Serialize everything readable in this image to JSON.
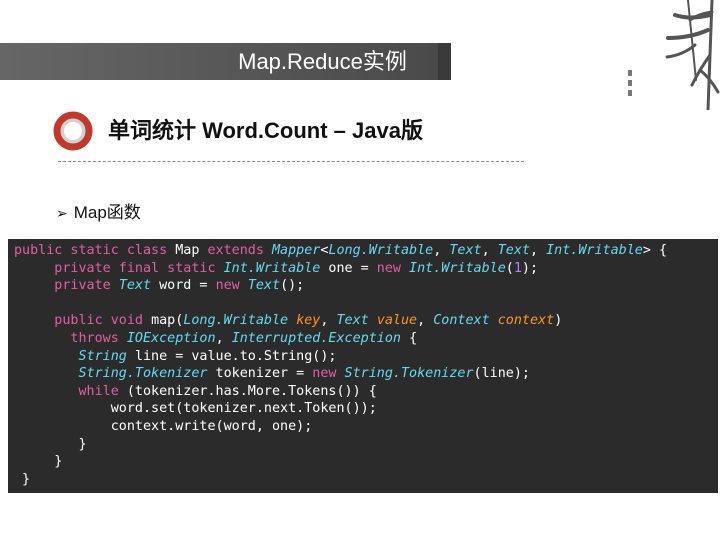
{
  "header": {
    "title": "Map.Reduce实例"
  },
  "section": {
    "subtitle": "单词统计 Word.Count – Java版",
    "bullet_label": "Map函数"
  },
  "code": {
    "lines": [
      [
        [
          "kw",
          "public static class "
        ],
        [
          "pl",
          "Map "
        ],
        [
          "kw",
          "extends "
        ],
        [
          "ty",
          "Mapper"
        ],
        [
          "pl",
          "<"
        ],
        [
          "ty",
          "Long.Writable"
        ],
        [
          "pl",
          ", "
        ],
        [
          "ty",
          "Text"
        ],
        [
          "pl",
          ", "
        ],
        [
          "ty",
          "Text"
        ],
        [
          "pl",
          ", "
        ],
        [
          "ty",
          "Int.Writable"
        ],
        [
          "pl",
          "> {"
        ]
      ],
      [
        [
          "kw",
          "     private final static "
        ],
        [
          "ty",
          "Int.Writable "
        ],
        [
          "pl",
          "one = "
        ],
        [
          "kw",
          "new "
        ],
        [
          "ty",
          "Int.Writable"
        ],
        [
          "pl",
          "("
        ],
        [
          "nu",
          "1"
        ],
        [
          "pl",
          ");"
        ]
      ],
      [
        [
          "kw",
          "     private "
        ],
        [
          "ty",
          "Text "
        ],
        [
          "pl",
          "word = "
        ],
        [
          "kw",
          "new "
        ],
        [
          "ty",
          "Text"
        ],
        [
          "pl",
          "();"
        ]
      ],
      [
        [
          "pl",
          ""
        ]
      ],
      [
        [
          "kw",
          "     public void "
        ],
        [
          "pl",
          "map("
        ],
        [
          "ty",
          "Long.Writable "
        ],
        [
          "pa",
          "key"
        ],
        [
          "pl",
          ", "
        ],
        [
          "ty",
          "Text "
        ],
        [
          "pa",
          "value"
        ],
        [
          "pl",
          ", "
        ],
        [
          "ty",
          "Context "
        ],
        [
          "pa",
          "context"
        ],
        [
          "pl",
          ")"
        ]
      ],
      [
        [
          "kw",
          "       throws "
        ],
        [
          "ty",
          "IOException"
        ],
        [
          "pl",
          ", "
        ],
        [
          "ty",
          "Interrupted.Exception "
        ],
        [
          "pl",
          "{"
        ]
      ],
      [
        [
          "ty",
          "        String "
        ],
        [
          "pl",
          "line = value.to.String();"
        ]
      ],
      [
        [
          "ty",
          "        String.Tokenizer "
        ],
        [
          "pl",
          "tokenizer = "
        ],
        [
          "kw",
          "new "
        ],
        [
          "ty",
          "String.Tokenizer"
        ],
        [
          "pl",
          "(line);"
        ]
      ],
      [
        [
          "kw",
          "        while "
        ],
        [
          "pl",
          "(tokenizer.has.More.Tokens()) {"
        ]
      ],
      [
        [
          "pl",
          "            word.set(tokenizer.next.Token());"
        ]
      ],
      [
        [
          "pl",
          "            context.write(word, one);"
        ]
      ],
      [
        [
          "pl",
          "        }"
        ]
      ],
      [
        [
          "pl",
          "     }"
        ]
      ],
      [
        [
          "pl",
          " }"
        ]
      ]
    ]
  },
  "colors": {
    "keyword": "#e05fa5",
    "type": "#66d9ef",
    "param": "#fd971f",
    "number": "#ae81ff",
    "code_bg": "#2b2b2b",
    "title_bar": "#555555"
  }
}
